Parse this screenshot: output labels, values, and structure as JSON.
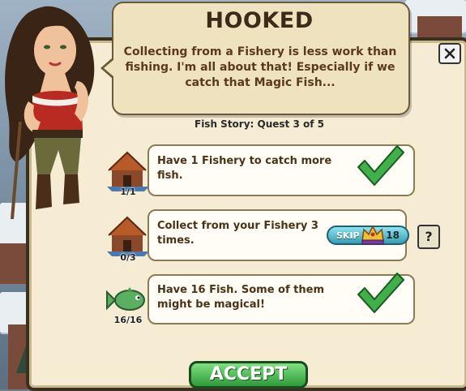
{
  "quest": {
    "title": "HOOKED",
    "dialog": "Collecting from a Fishery is less work than fishing. I'm all about that! Especially if we catch that Magic Fish...",
    "subtitle": "Fish Story: Quest 3 of 5"
  },
  "tasks": [
    {
      "text": "Have 1 Fishery to catch more fish.",
      "progress": "1/1",
      "complete": true,
      "icon": "fishery-icon"
    },
    {
      "text": "Collect from your Fishery 3 times.",
      "progress": "0/3",
      "complete": false,
      "icon": "fishery-icon"
    },
    {
      "text": "Have 16 Fish. Some of them might be magical!",
      "progress": "16/16",
      "complete": true,
      "icon": "fish-icon"
    }
  ],
  "skip": {
    "label": "SKIP",
    "cost": "18",
    "icon": "crown-icon"
  },
  "help_label": "?",
  "accept_label": "ACCEPT",
  "colors": {
    "panel": "#f5ecd3",
    "check": "#2e9a3a",
    "accept": "#3fb04a",
    "skip": "#5cc0d0"
  }
}
